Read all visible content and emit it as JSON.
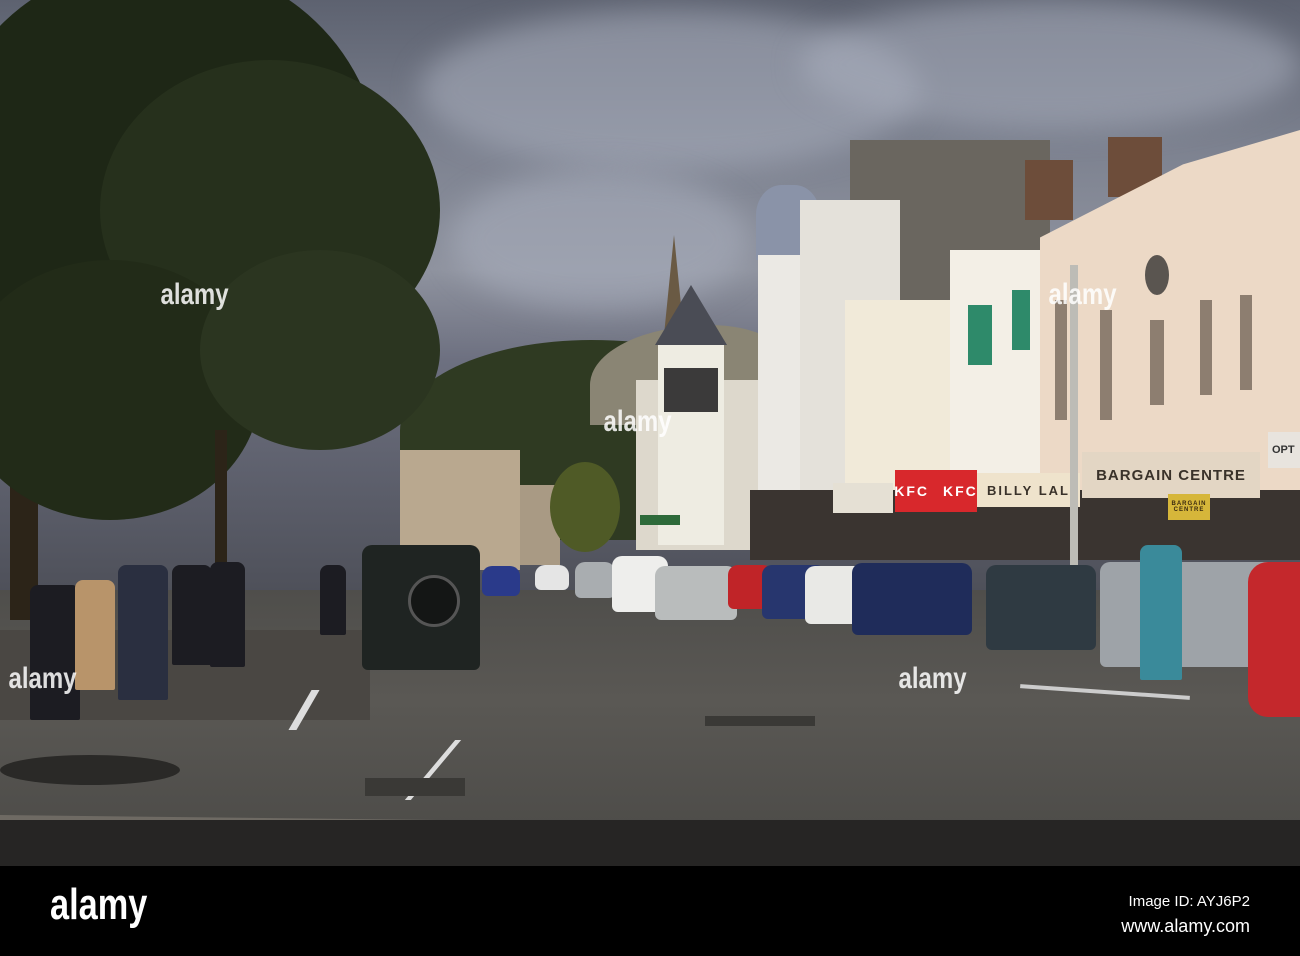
{
  "photo": {
    "signs": {
      "kfc_left": "KFC",
      "kfc_right": "KFC",
      "billy_lal": "BILLY LAL",
      "bargain_centre": "BARGAIN CENTRE",
      "bargain_window_1": "BARGAIN",
      "bargain_window_2": "CENTRE",
      "opt_sign": "OPT"
    },
    "watermark": "alamy"
  },
  "footer": {
    "logo": "alamy",
    "image_id": "Image ID: AYJ6P2",
    "url": "www.alamy.com"
  }
}
